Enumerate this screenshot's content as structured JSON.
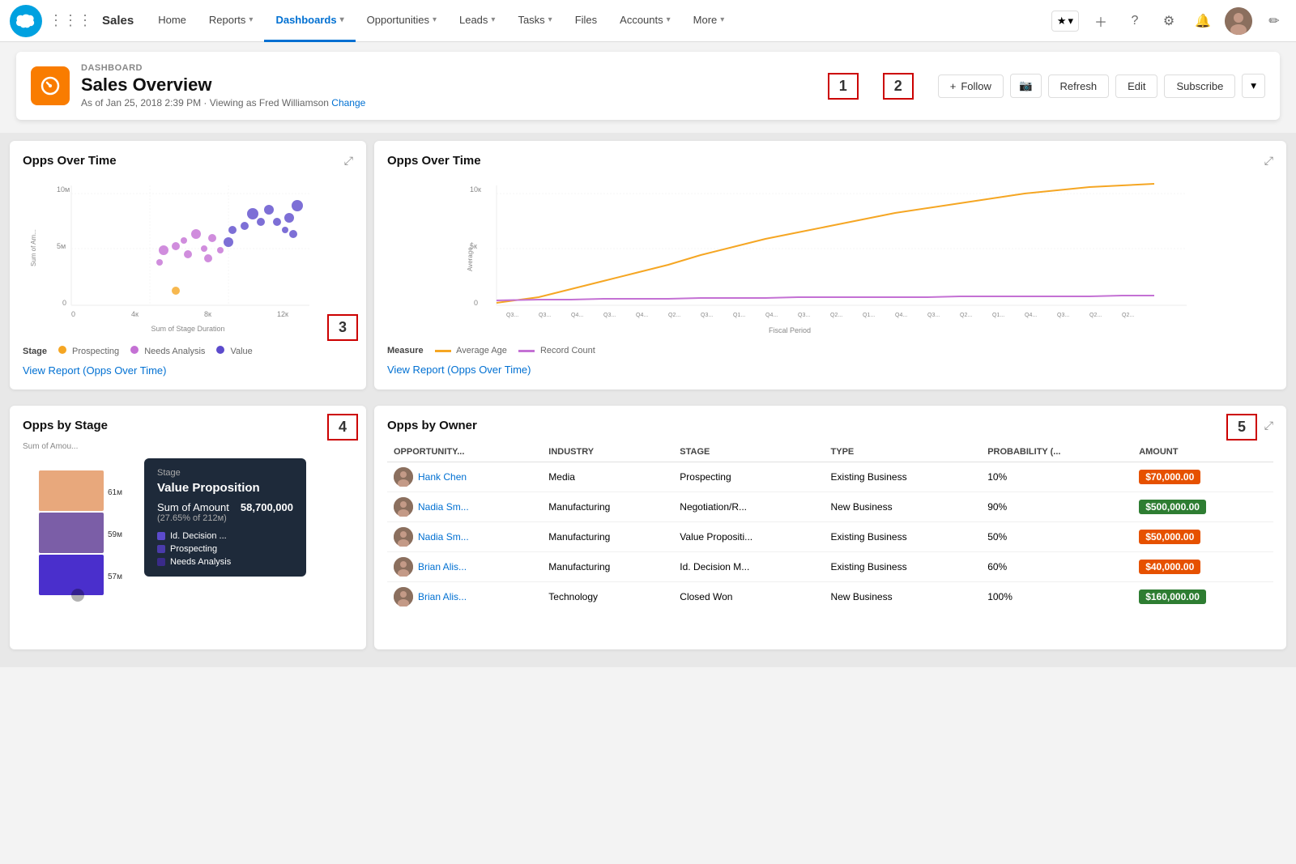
{
  "app": {
    "name": "Sales"
  },
  "nav": {
    "items": [
      {
        "label": "Home",
        "has_caret": false,
        "active": false
      },
      {
        "label": "Reports",
        "has_caret": true,
        "active": false
      },
      {
        "label": "Dashboards",
        "has_caret": true,
        "active": true
      },
      {
        "label": "Opportunities",
        "has_caret": true,
        "active": false
      },
      {
        "label": "Leads",
        "has_caret": true,
        "active": false
      },
      {
        "label": "Tasks",
        "has_caret": true,
        "active": false
      },
      {
        "label": "Files",
        "has_caret": false,
        "active": false
      },
      {
        "label": "Accounts",
        "has_caret": true,
        "active": false
      },
      {
        "label": "More",
        "has_caret": true,
        "active": false
      }
    ]
  },
  "header": {
    "label": "DASHBOARD",
    "title": "Sales Overview",
    "subtitle": "As of Jan 25, 2018 2:39 PM · Viewing as Fred Williamson",
    "change_link": "Change",
    "follow_label": "Follow",
    "refresh_label": "Refresh",
    "edit_label": "Edit",
    "subscribe_label": "Subscribe",
    "anno_1": "1",
    "anno_2": "2"
  },
  "widget1": {
    "title": "Opps Over Time",
    "x_label": "Sum of Stage Duration",
    "y_label": "Sum of Am...",
    "y_ticks": [
      "10м",
      "5м",
      "0"
    ],
    "x_ticks": [
      "0",
      "4к",
      "8к",
      "12к"
    ],
    "legend": {
      "label": "Stage",
      "items": [
        {
          "color": "#f5a623",
          "label": "Prospecting"
        },
        {
          "color": "#c471d4",
          "label": "Needs Analysis"
        },
        {
          "color": "#5c4bcc",
          "label": "Value"
        }
      ]
    },
    "view_report": "View Report (Opps Over Time)",
    "anno_3": "3"
  },
  "widget2": {
    "title": "Opps Over Time",
    "y_label": "Average...",
    "y_ticks": [
      "10к",
      "5к",
      "0"
    ],
    "x_label": "Fiscal Period",
    "legend": {
      "label": "Measure",
      "items": [
        {
          "color": "#f5a623",
          "label": "Average Age"
        },
        {
          "color": "#c471d4",
          "label": "Record Count"
        }
      ]
    },
    "view_report": "View Report (Opps Over Time)"
  },
  "widget3": {
    "title": "Opps by Stage",
    "y_label": "Sum of Amou...",
    "bar_values": [
      "61м",
      "59м",
      "57м"
    ],
    "tooltip": {
      "stage_label": "Stage",
      "stage_value": "Value Proposition",
      "amount_label": "Sum of Amount",
      "amount_value": "58,700,000",
      "pct_value": "(27.65% of 212м)"
    },
    "legend_items": [
      {
        "color": "#5c4bcc",
        "label": "Id. Decision ..."
      },
      {
        "color": "#4a3bab",
        "label": "Prospecting"
      },
      {
        "color": "#3a2b8a",
        "label": "Needs Analysis"
      }
    ],
    "anno_4": "4"
  },
  "widget4": {
    "title": "Opps by Owner",
    "anno_5": "5",
    "columns": [
      "OPPORTUNITY...",
      "INDUSTRY",
      "STAGE",
      "TYPE",
      "PROBABILITY (...",
      "AMOUNT"
    ],
    "rows": [
      {
        "name": "Hank Chen",
        "industry": "Media",
        "stage": "Prospecting",
        "type": "Existing Business",
        "probability": "10%",
        "amount": "$70,000.00",
        "amount_color": "orange"
      },
      {
        "name": "Nadia Sm...",
        "industry": "Manufacturing",
        "stage": "Negotiation/R...",
        "type": "New Business",
        "probability": "90%",
        "amount": "$500,000.00",
        "amount_color": "green"
      },
      {
        "name": "Nadia Sm...",
        "industry": "Manufacturing",
        "stage": "Value Propositi...",
        "type": "Existing Business",
        "probability": "50%",
        "amount": "$50,000.00",
        "amount_color": "orange"
      },
      {
        "name": "Brian Alis...",
        "industry": "Manufacturing",
        "stage": "Id. Decision M...",
        "type": "Existing Business",
        "probability": "60%",
        "amount": "$40,000.00",
        "amount_color": "orange"
      },
      {
        "name": "Brian Alis...",
        "industry": "Technology",
        "stage": "Closed Won",
        "type": "New Business",
        "probability": "100%",
        "amount": "$160,000.00",
        "amount_color": "green"
      }
    ]
  }
}
